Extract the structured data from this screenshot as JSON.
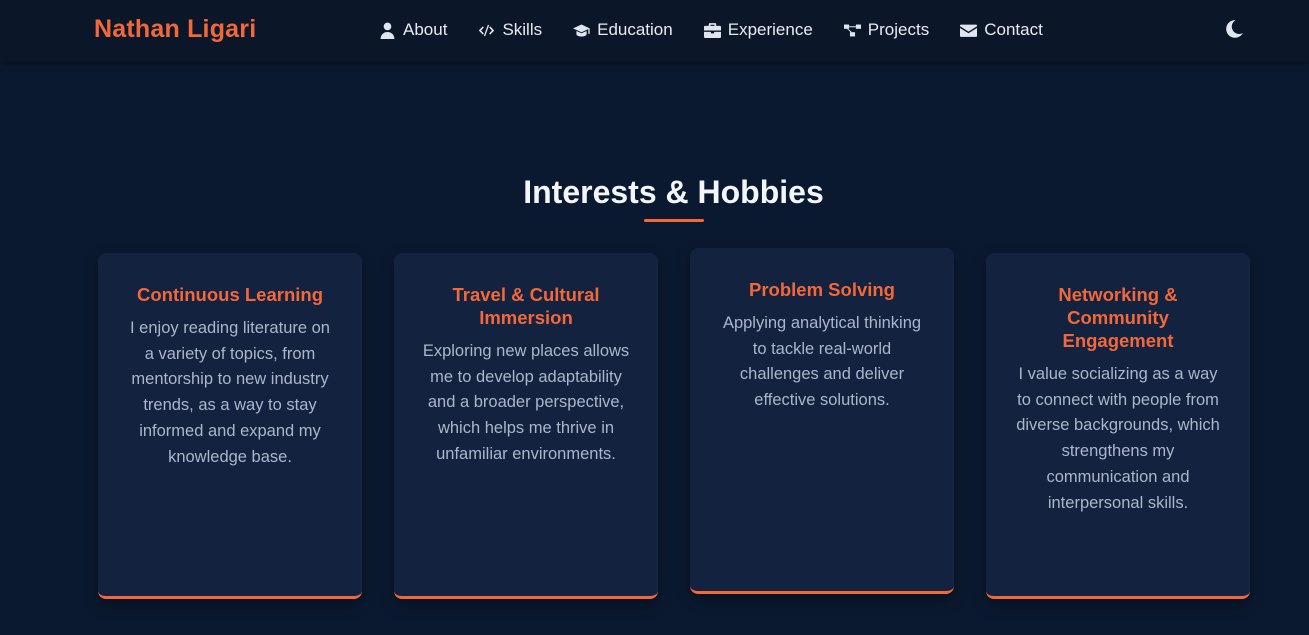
{
  "brand": {
    "name": "Nathan Ligari",
    "color": "#f2683a"
  },
  "nav": {
    "items": [
      {
        "label": "About",
        "icon": "user-icon"
      },
      {
        "label": "Skills",
        "icon": "code-icon"
      },
      {
        "label": "Education",
        "icon": "graduation-cap-icon"
      },
      {
        "label": "Experience",
        "icon": "briefcase-icon"
      },
      {
        "label": "Projects",
        "icon": "project-diagram-icon"
      },
      {
        "label": "Contact",
        "icon": "envelope-icon"
      }
    ],
    "theme_toggle_icon": "moon-icon"
  },
  "section": {
    "title": "Interests & Hobbies",
    "cards": [
      {
        "title": "Continuous Learning",
        "text": "I enjoy reading literature on a variety of topics, from mentorship to new industry trends, as a way to stay informed and expand my knowledge base."
      },
      {
        "title": "Travel & Cultural Immersion",
        "text": "Exploring new places allows me to develop adaptability and a broader perspective, which helps me thrive in unfamiliar environments."
      },
      {
        "title": "Problem Solving",
        "text": "Applying analytical thinking to tackle real-world challenges and deliver effective solutions."
      },
      {
        "title": "Networking & Community Engagement",
        "text": "I value socializing as a way to connect with people from diverse backgrounds, which strengthens my communication and interpersonal skills."
      }
    ]
  },
  "colors": {
    "accent": "#f2683a",
    "background": "#0b1930",
    "card": "#13223f"
  }
}
